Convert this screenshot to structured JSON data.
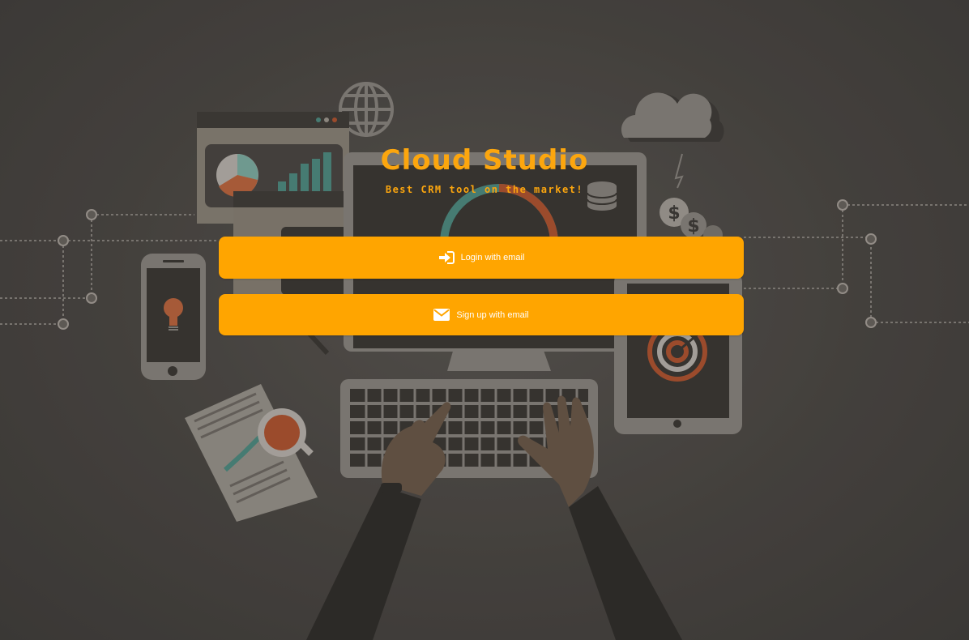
{
  "brand": {
    "title": "Cloud Studio",
    "tagline": "Best CRM tool on the market!"
  },
  "actions": {
    "login_label": "Login with email",
    "signup_label": "Sign up with email",
    "login_icon": "sign-in-icon",
    "signup_icon": "envelope-icon"
  },
  "background": {
    "illustration_icons": [
      "globe-icon",
      "cloud-icon",
      "dollar-coin-icon",
      "database-icon",
      "lightbulb-icon",
      "target-icon",
      "pie-chart-icon",
      "bar-chart-icon",
      "coffee-cup-icon",
      "keyboard-icon"
    ]
  },
  "colors": {
    "accent": "#ffa500",
    "title": "#fca60e",
    "background": "#4a4643"
  }
}
